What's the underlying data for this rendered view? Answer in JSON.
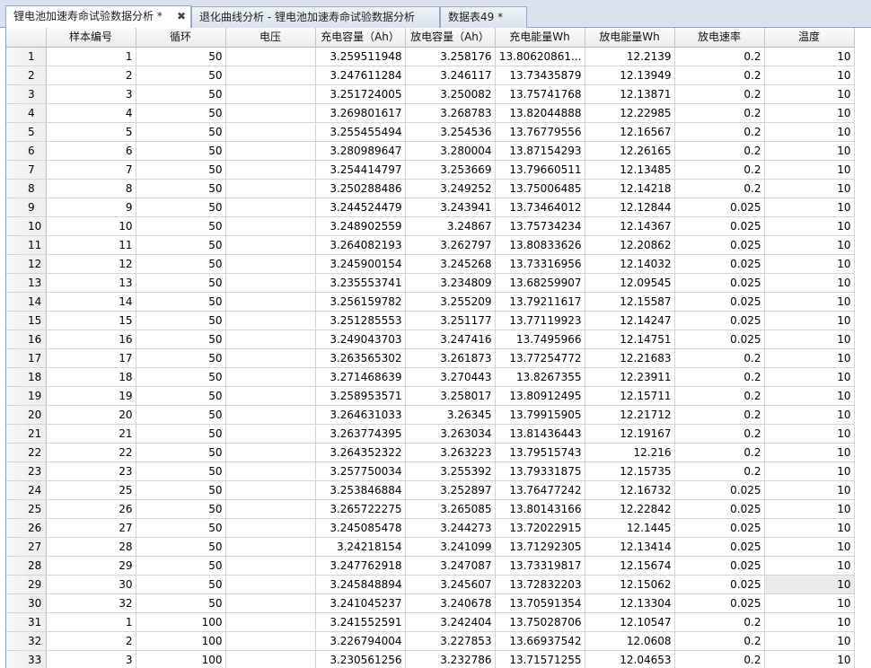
{
  "tabs": [
    {
      "label": "锂电池加速寿命试验数据分析 *",
      "active": true,
      "closable": true
    },
    {
      "label": "退化曲线分析 - 锂电池加速寿命试验数据分析",
      "active": false,
      "closable": false
    },
    {
      "label": "数据表49 *",
      "active": false,
      "closable": false
    }
  ],
  "table": {
    "columns": [
      "",
      "样本编号",
      "循环",
      "电压",
      "充电容量（Ah）",
      "放电容量（Ah）",
      "充电能量Wh",
      "放电能量Wh",
      "放电速率",
      "温度"
    ],
    "rows": [
      [
        "1",
        "1",
        "50",
        "",
        "3.259511948",
        "3.258176",
        "13.80620861...",
        "12.2139",
        "0.2",
        "10"
      ],
      [
        "2",
        "2",
        "50",
        "",
        "3.247611284",
        "3.246117",
        "13.73435879",
        "12.13949",
        "0.2",
        "10"
      ],
      [
        "3",
        "3",
        "50",
        "",
        "3.251724005",
        "3.250082",
        "13.75741768",
        "12.13871",
        "0.2",
        "10"
      ],
      [
        "4",
        "4",
        "50",
        "",
        "3.269801617",
        "3.268783",
        "13.82044888",
        "12.22985",
        "0.2",
        "10"
      ],
      [
        "5",
        "5",
        "50",
        "",
        "3.255455494",
        "3.254536",
        "13.76779556",
        "12.16567",
        "0.2",
        "10"
      ],
      [
        "6",
        "6",
        "50",
        "",
        "3.280989647",
        "3.280004",
        "13.87154293",
        "12.26165",
        "0.2",
        "10"
      ],
      [
        "7",
        "7",
        "50",
        "",
        "3.254414797",
        "3.253669",
        "13.79660511",
        "12.13485",
        "0.2",
        "10"
      ],
      [
        "8",
        "8",
        "50",
        "",
        "3.250288486",
        "3.249252",
        "13.75006485",
        "12.14218",
        "0.2",
        "10"
      ],
      [
        "9",
        "9",
        "50",
        "",
        "3.244524479",
        "3.243941",
        "13.73464012",
        "12.12844",
        "0.025",
        "10"
      ],
      [
        "10",
        "10",
        "50",
        "",
        "3.248902559",
        "3.24867",
        "13.75734234",
        "12.14367",
        "0.025",
        "10"
      ],
      [
        "11",
        "11",
        "50",
        "",
        "3.264082193",
        "3.262797",
        "13.80833626",
        "12.20862",
        "0.025",
        "10"
      ],
      [
        "12",
        "12",
        "50",
        "",
        "3.245900154",
        "3.245268",
        "13.73316956",
        "12.14032",
        "0.025",
        "10"
      ],
      [
        "13",
        "13",
        "50",
        "",
        "3.235553741",
        "3.234809",
        "13.68259907",
        "12.09545",
        "0.025",
        "10"
      ],
      [
        "14",
        "14",
        "50",
        "",
        "3.256159782",
        "3.255209",
        "13.79211617",
        "12.15587",
        "0.025",
        "10"
      ],
      [
        "15",
        "15",
        "50",
        "",
        "3.251285553",
        "3.251177",
        "13.77119923",
        "12.14247",
        "0.025",
        "10"
      ],
      [
        "16",
        "16",
        "50",
        "",
        "3.249043703",
        "3.247416",
        "13.7495966",
        "12.14751",
        "0.025",
        "10"
      ],
      [
        "17",
        "17",
        "50",
        "",
        "3.263565302",
        "3.261873",
        "13.77254772",
        "12.21683",
        "0.2",
        "10"
      ],
      [
        "18",
        "18",
        "50",
        "",
        "3.271468639",
        "3.270443",
        "13.8267355",
        "12.23911",
        "0.2",
        "10"
      ],
      [
        "19",
        "19",
        "50",
        "",
        "3.258953571",
        "3.258017",
        "13.80912495",
        "12.15711",
        "0.2",
        "10"
      ],
      [
        "20",
        "20",
        "50",
        "",
        "3.264631033",
        "3.26345",
        "13.79915905",
        "12.21712",
        "0.2",
        "10"
      ],
      [
        "21",
        "21",
        "50",
        "",
        "3.263774395",
        "3.263034",
        "13.81436443",
        "12.19167",
        "0.2",
        "10"
      ],
      [
        "22",
        "22",
        "50",
        "",
        "3.264352322",
        "3.263223",
        "13.79515743",
        "12.216",
        "0.2",
        "10"
      ],
      [
        "23",
        "23",
        "50",
        "",
        "3.257750034",
        "3.255392",
        "13.79331875",
        "12.15735",
        "0.2",
        "10"
      ],
      [
        "24",
        "25",
        "50",
        "",
        "3.253846884",
        "3.252897",
        "13.76477242",
        "12.16732",
        "0.025",
        "10"
      ],
      [
        "25",
        "26",
        "50",
        "",
        "3.265722275",
        "3.265085",
        "13.80143166",
        "12.22842",
        "0.025",
        "10"
      ],
      [
        "26",
        "27",
        "50",
        "",
        "3.245085478",
        "3.244273",
        "13.72022915",
        "12.1445",
        "0.025",
        "10"
      ],
      [
        "27",
        "28",
        "50",
        "",
        "3.24218154",
        "3.241099",
        "13.71292305",
        "12.13414",
        "0.025",
        "10"
      ],
      [
        "28",
        "29",
        "50",
        "",
        "3.247762918",
        "3.247087",
        "13.73319817",
        "12.15674",
        "0.025",
        "10"
      ],
      [
        "29",
        "30",
        "50",
        "",
        "3.245848894",
        "3.245607",
        "13.72832203",
        "12.15062",
        "0.025",
        "10"
      ],
      [
        "30",
        "32",
        "50",
        "",
        "3.241045237",
        "3.240678",
        "13.70591354",
        "12.13304",
        "0.025",
        "10"
      ],
      [
        "31",
        "1",
        "100",
        "",
        "3.241552591",
        "3.242404",
        "13.75028706",
        "12.10547",
        "0.2",
        "10"
      ],
      [
        "32",
        "2",
        "100",
        "",
        "3.226794004",
        "3.227853",
        "13.66937542",
        "12.0608",
        "0.2",
        "10"
      ],
      [
        "33",
        "3",
        "100",
        "",
        "3.230561256",
        "3.232786",
        "13.71571255",
        "12.04653",
        "0.2",
        "10"
      ]
    ]
  },
  "close_symbol": "✖"
}
